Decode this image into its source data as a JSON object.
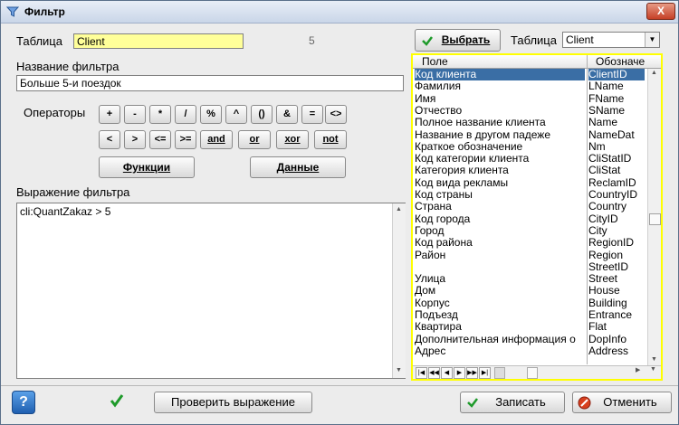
{
  "window": {
    "title": "Фильтр",
    "close": "X"
  },
  "table_label": "Таблица",
  "table_value": "Client",
  "count": "5",
  "filter_name_label": "Название фильтра",
  "filter_name_value": "Больше 5-и поездок",
  "operators_label": "Операторы",
  "operators_row1": [
    "+",
    "-",
    "*",
    "/",
    "%",
    "^",
    "()",
    "&",
    "=",
    "<>"
  ],
  "operators_row2": [
    "<",
    ">",
    "<=",
    ">=",
    "and",
    "or",
    "xor",
    "not"
  ],
  "functions_label": "Функции",
  "data_label": "Данные",
  "expression_label": "Выражение фильтра",
  "expression_value": "cli:QuantZakaz > 5",
  "select_button": "Выбрать",
  "right_table_label": "Таблица",
  "right_table_value": "Client",
  "grid": {
    "col_field": "Поле",
    "col_alias": "Обозначе",
    "rows": [
      [
        "Код клиента",
        "ClientID"
      ],
      [
        "Фамилия",
        "LName"
      ],
      [
        "Имя",
        "FName"
      ],
      [
        "Отчество",
        "SName"
      ],
      [
        "Полное название клиента",
        "Name"
      ],
      [
        "Название в другом падеже",
        "NameDat"
      ],
      [
        "Краткое обозначение",
        "Nm"
      ],
      [
        "Код категории клиента",
        "CliStatID"
      ],
      [
        "Категория клиента",
        "CliStat"
      ],
      [
        "Код вида рекламы",
        "ReclamID"
      ],
      [
        "Код страны",
        "CountryID"
      ],
      [
        "Страна",
        "Country"
      ],
      [
        "Код города",
        "CityID"
      ],
      [
        "Город",
        "City"
      ],
      [
        "Код района",
        "RegionID"
      ],
      [
        "Район",
        "Region"
      ],
      [
        "",
        "StreetID"
      ],
      [
        "Улица",
        "Street"
      ],
      [
        "Дом",
        "House"
      ],
      [
        "Корпус",
        "Building"
      ],
      [
        "Подъезд",
        "Entrance"
      ],
      [
        "Квартира",
        "Flat"
      ],
      [
        "Дополнительная информация о",
        "DopInfo"
      ],
      [
        "Адрес",
        "Address"
      ]
    ]
  },
  "check_button": "Проверить выражение",
  "save_button": "Записать",
  "cancel_button": "Отменить",
  "colors": {
    "highlight": "#ffff00",
    "selection": "#3a6ea5",
    "table_field": "#ffff99"
  }
}
